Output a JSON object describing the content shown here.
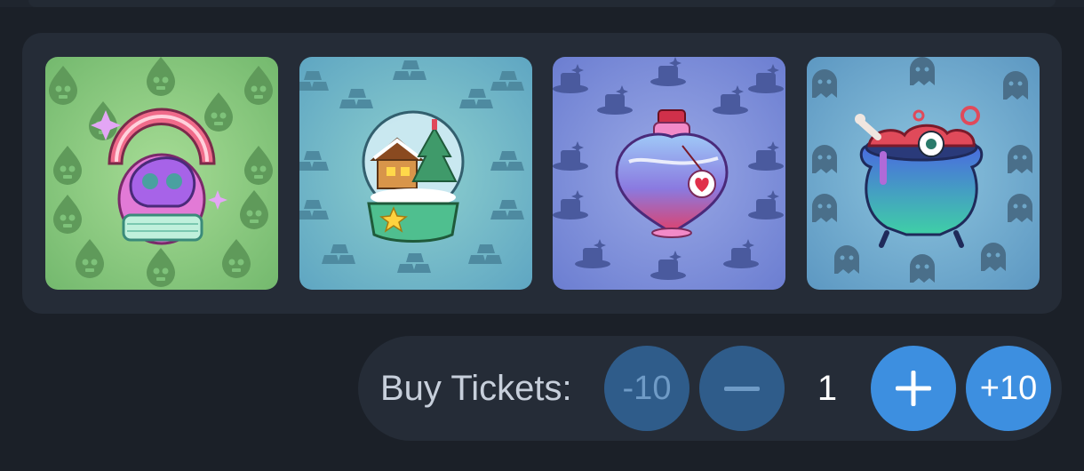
{
  "items": [
    {
      "name": "Skull Mushroom Globe",
      "icon": "skull-mushroom-globe-icon",
      "bg": "#7ec27a",
      "pattern": "skull-drop"
    },
    {
      "name": "Snow Globe",
      "icon": "snow-globe-icon",
      "bg": "#6fb6c4",
      "pattern": "gold-bars"
    },
    {
      "name": "Love Potion",
      "icon": "love-potion-icon",
      "bg": "#7f8fd6",
      "pattern": "magic-hat"
    },
    {
      "name": "Witch Cauldron",
      "icon": "cauldron-icon",
      "bg": "#6fa9cf",
      "pattern": "ghost"
    }
  ],
  "tickets": {
    "label": "Buy Tickets:",
    "minus10_label": "-10",
    "quantity": "1",
    "plus10_label": "+10"
  },
  "colors": {
    "background": "#1b2028",
    "panel": "#252c37",
    "button_active": "#3d8fe0",
    "button_disabled": "#2f5c8a"
  }
}
